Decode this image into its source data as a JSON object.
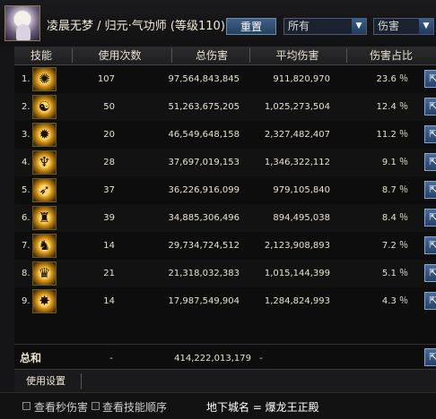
{
  "character": {
    "name": "凌晨无梦",
    "class_info": "归元·气功师 (等级110)",
    "title_sep": " / "
  },
  "controls": {
    "reset_label": "重置",
    "filter_selected": "所有",
    "metric_selected": "伤害"
  },
  "columns": {
    "skill": "技能",
    "uses": "使用次数",
    "total": "总伤害",
    "average": "平均伤害",
    "percent": "伤害占比"
  },
  "rows": [
    {
      "rank": "1.",
      "uses": "107",
      "total": "97,564,843,845",
      "average": "911,820,970",
      "percent": "23.6 ％"
    },
    {
      "rank": "2.",
      "uses": "50",
      "total": "51,263,675,205",
      "average": "1,025,273,504",
      "percent": "12.4 ％"
    },
    {
      "rank": "3.",
      "uses": "20",
      "total": "46,549,648,158",
      "average": "2,327,482,407",
      "percent": "11.2 ％"
    },
    {
      "rank": "4.",
      "uses": "28",
      "total": "37,697,019,153",
      "average": "1,346,322,112",
      "percent": "9.1 ％"
    },
    {
      "rank": "5.",
      "uses": "37",
      "total": "36,226,916,099",
      "average": "979,105,840",
      "percent": "8.7 ％"
    },
    {
      "rank": "6.",
      "uses": "39",
      "total": "34,885,306,496",
      "average": "894,495,038",
      "percent": "8.4 ％"
    },
    {
      "rank": "7.",
      "uses": "14",
      "total": "29,734,724,512",
      "average": "2,123,908,893",
      "percent": "7.2 ％"
    },
    {
      "rank": "8.",
      "uses": "21",
      "total": "21,318,032,383",
      "average": "1,015,144,399",
      "percent": "5.1 ％"
    },
    {
      "rank": "9.",
      "uses": "14",
      "total": "17,987,549,904",
      "average": "1,284,824,993",
      "percent": "4.3 ％"
    }
  ],
  "totals": {
    "label": "总和",
    "uses": "-",
    "total": "414,222,013,179",
    "average": "-"
  },
  "usage_settings_label": "使用设置",
  "footer": {
    "per_second_label": "查看秒伤害",
    "skill_order_label": "查看技能顺序",
    "dungeon_text": "地下城名 = 爆龙王正殿"
  },
  "icons": {
    "skill_icons": [
      "flame-palm-icon",
      "meditation-figure-icon",
      "burst-palm-icon",
      "warrior-stance-icon",
      "wind-strike-icon",
      "monk-figure-icon",
      "dragon-head-icon",
      "guardian-figure-icon",
      "explosion-icon"
    ],
    "share": "share-export-icon",
    "dropdown": "chevron-down-icon"
  },
  "colors": {
    "reset_button": "#3f5f86",
    "share_button": "#4a6c98",
    "skill_icon_gold": "#ffd86a"
  }
}
